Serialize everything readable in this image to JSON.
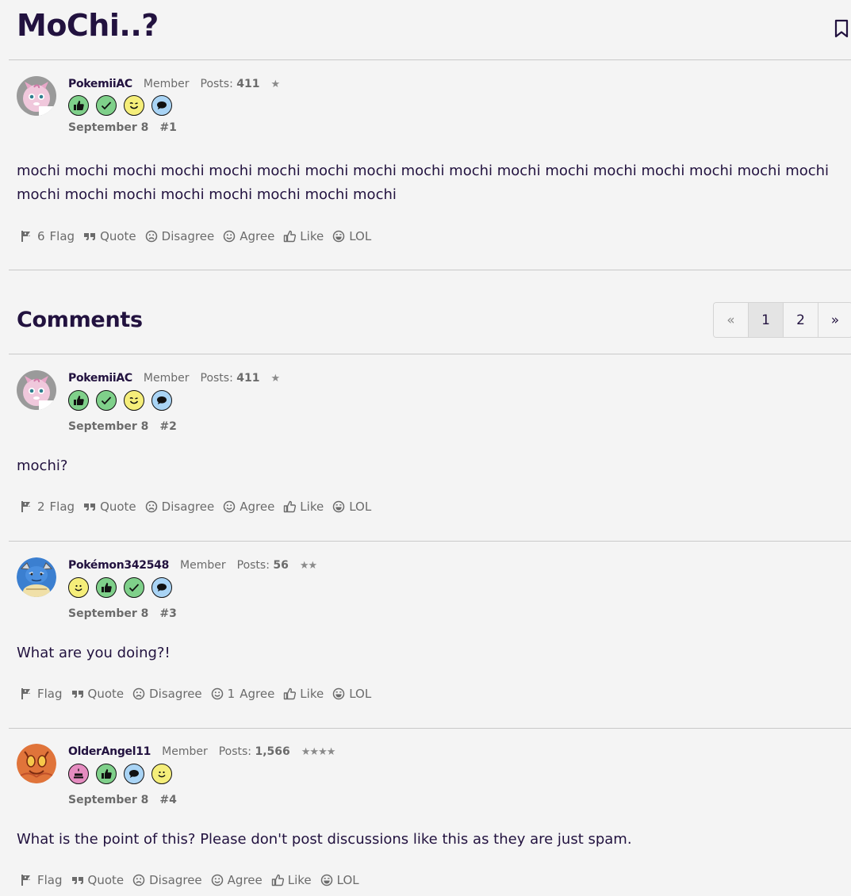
{
  "topic": {
    "title": "MoChi..?"
  },
  "original_post": {
    "username": "PokemiiAC",
    "role": "Member",
    "posts_label": "Posts:",
    "posts": "411",
    "stars": "★",
    "badges": [
      "thumbs-up-badge",
      "check-badge",
      "wink-badge",
      "chat-badge"
    ],
    "date": "September 8",
    "number": "#1",
    "text": "mochi mochi mochi mochi mochi mochi mochi mochi mochi mochi mochi mochi mochi mochi mochi mochi mochi mochi mochi mochi mochi mochi mochi mochi mochi",
    "actions": {
      "flag_count": "6",
      "flag": "Flag",
      "quote": "Quote",
      "disagree": "Disagree",
      "agree": "Agree",
      "like": "Like",
      "lol": "LOL"
    }
  },
  "comments": {
    "heading": "Comments",
    "pagination": {
      "prev": "«",
      "pages": [
        "1",
        "2"
      ],
      "next": "»",
      "current": "1"
    },
    "items": [
      {
        "username": "PokemiiAC",
        "role": "Member",
        "posts_label": "Posts:",
        "posts": "411",
        "stars": "★",
        "badges": [
          "thumbs-up-badge",
          "check-badge",
          "wink-badge",
          "chat-badge"
        ],
        "date": "September 8",
        "number": "#2",
        "text": "mochi?",
        "actions": {
          "flag_count": "2",
          "flag": "Flag",
          "quote": "Quote",
          "disagree": "Disagree",
          "agree_count": "",
          "agree": "Agree",
          "like": "Like",
          "lol": "LOL"
        }
      },
      {
        "username": "Pokémon342548",
        "role": "Member",
        "posts_label": "Posts:",
        "posts": "56",
        "stars": "★★",
        "badges": [
          "smile-badge",
          "thumbs-up-badge",
          "check-badge",
          "chat-badge"
        ],
        "date": "September 8",
        "number": "#3",
        "text": "What are you doing?!",
        "actions": {
          "flag_count": "",
          "flag": "Flag",
          "quote": "Quote",
          "disagree": "Disagree",
          "agree_count": "1",
          "agree": "Agree",
          "like": "Like",
          "lol": "LOL"
        }
      },
      {
        "username": "OlderAngel11",
        "role": "Member",
        "posts_label": "Posts:",
        "posts": "1,566",
        "stars": "★★★★",
        "badges": [
          "cake-badge",
          "thumbs-up-badge",
          "chat-badge",
          "smile-badge"
        ],
        "date": "September 8",
        "number": "#4",
        "text": "What is the point of this? Please don't post discussions like this as they are just spam.",
        "actions": {
          "flag_count": "",
          "flag": "Flag",
          "quote": "Quote",
          "disagree": "Disagree",
          "agree_count": "",
          "agree": "Agree",
          "like": "Like",
          "lol": "LOL"
        }
      }
    ]
  },
  "colors": {
    "background": "#f4f4f4",
    "text": "#22123f",
    "muted": "#6b6b6b",
    "divider": "#c9c9c9",
    "badge_green": "#7fd08a",
    "badge_yellow": "#f5ee7a",
    "badge_blue": "#a9d4f5",
    "badge_pink": "#e58cc0"
  }
}
